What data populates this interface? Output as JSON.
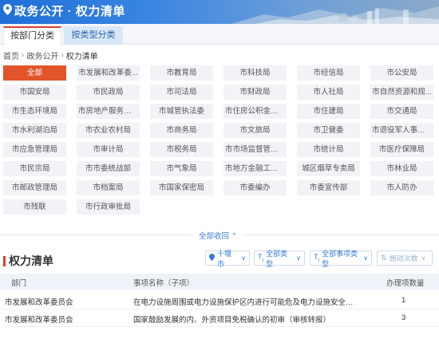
{
  "header": {
    "title": "政务公开 · 权力清单",
    "icon": "location-pin-icon"
  },
  "tabs": [
    {
      "label": "按部门分类",
      "active": true
    },
    {
      "label": "按类型分类",
      "active": false
    }
  ],
  "breadcrumb": {
    "items": [
      "首页",
      "政务公开",
      "权力清单"
    ]
  },
  "departments": [
    "全部",
    "市发展和改革委...",
    "市教育局",
    "市科技局",
    "市经信局",
    "市公安局",
    "市国安局",
    "市民政局",
    "市司法局",
    "市财政局",
    "市人社局",
    "市自然资源和规...",
    "市生态环境局",
    "市房地产服务中心",
    "市城管执法委",
    "市住房公积金中心",
    "市住建局",
    "市交通局",
    "市水利湖泊局",
    "市农业农村局",
    "市商务局",
    "市文旅局",
    "市卫健委",
    "市退役军人事务局",
    "市应急管理局",
    "市审计局",
    "市税务局",
    "市市场监督管理局",
    "市统计局",
    "市医疗保障局",
    "市民宗局",
    "市市委统战部",
    "市气象局",
    "市地方金融工作局",
    "城区烟草专卖局",
    "市林业局",
    "市邮政管理局",
    "市档案局",
    "市国家保密局",
    "市委编办",
    "市委宣传部",
    "市人防办",
    "市残联",
    "市行政审批局"
  ],
  "collapse_label": "全部收回 ⌃",
  "section": {
    "title": "权力清单"
  },
  "filters": {
    "location": "十堰市",
    "category": "全部类型",
    "item_type": "全部事项类型",
    "sort": "施动次数"
  },
  "table": {
    "headers": [
      "部门",
      "事项名称（子项）",
      "办理项数量"
    ],
    "rows": [
      {
        "dept": "市发展和改革委员会",
        "item": "在电力设施周围或电力设施保护区内进行可能危及电力设施安全作业的审批",
        "count": "1"
      },
      {
        "dept": "市发展和改革委员会",
        "item": "国家鼓励发展的内、外资项目免税确认的初审（审核转报）",
        "count": "3"
      }
    ]
  },
  "colors": {
    "accent": "#e2552b",
    "link": "#3a7bd5",
    "banner": "#1f6fd8"
  }
}
